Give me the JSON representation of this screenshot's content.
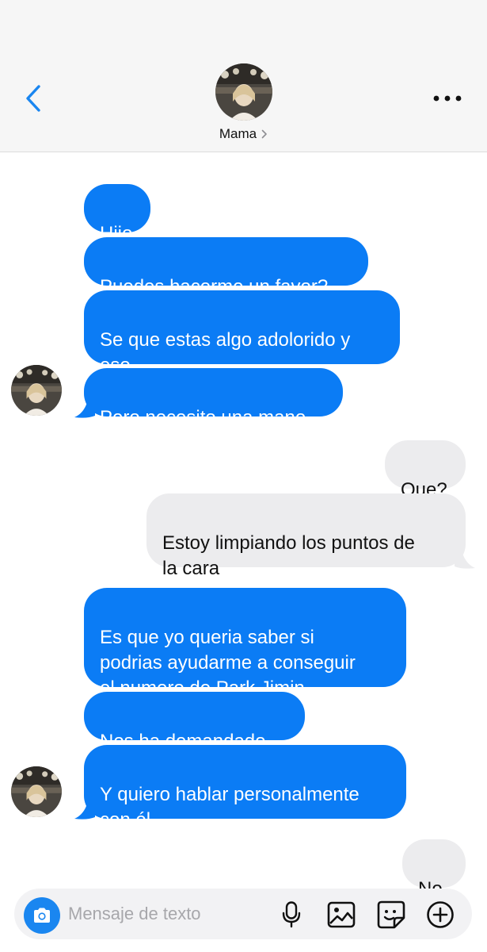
{
  "header": {
    "contact_name": "Mama",
    "back_icon": "chevron-left-icon",
    "more_icon": "ellipsis-icon"
  },
  "messages": [
    {
      "from": "contact",
      "text": "Hijo"
    },
    {
      "from": "contact",
      "text": "Puedes hacerme un favor?"
    },
    {
      "from": "contact",
      "text": "Se que estas algo adolorido y\neso"
    },
    {
      "from": "contact",
      "text": "Pero necesito una mano"
    },
    {
      "from": "me",
      "text": "Que?"
    },
    {
      "from": "me",
      "text": "Estoy limpiando los puntos de\nla cara"
    },
    {
      "from": "contact",
      "text": "Es que yo queria saber si\npodrias ayudarme a conseguir\nel numero de Park Jimin"
    },
    {
      "from": "contact",
      "text": "Nos ha demandado"
    },
    {
      "from": "contact",
      "text": "Y quiero hablar personalmente\ncon él"
    },
    {
      "from": "me",
      "text": "No"
    }
  ],
  "composer": {
    "placeholder": "Mensaje de texto",
    "value": "",
    "icons": [
      "camera-icon",
      "microphone-icon",
      "image-icon",
      "sticker-icon",
      "plus-circle-icon"
    ]
  },
  "colors": {
    "incoming_bubble": "#0b7cf5",
    "outgoing_bubble": "#ececee",
    "accent": "#1a86f0"
  }
}
